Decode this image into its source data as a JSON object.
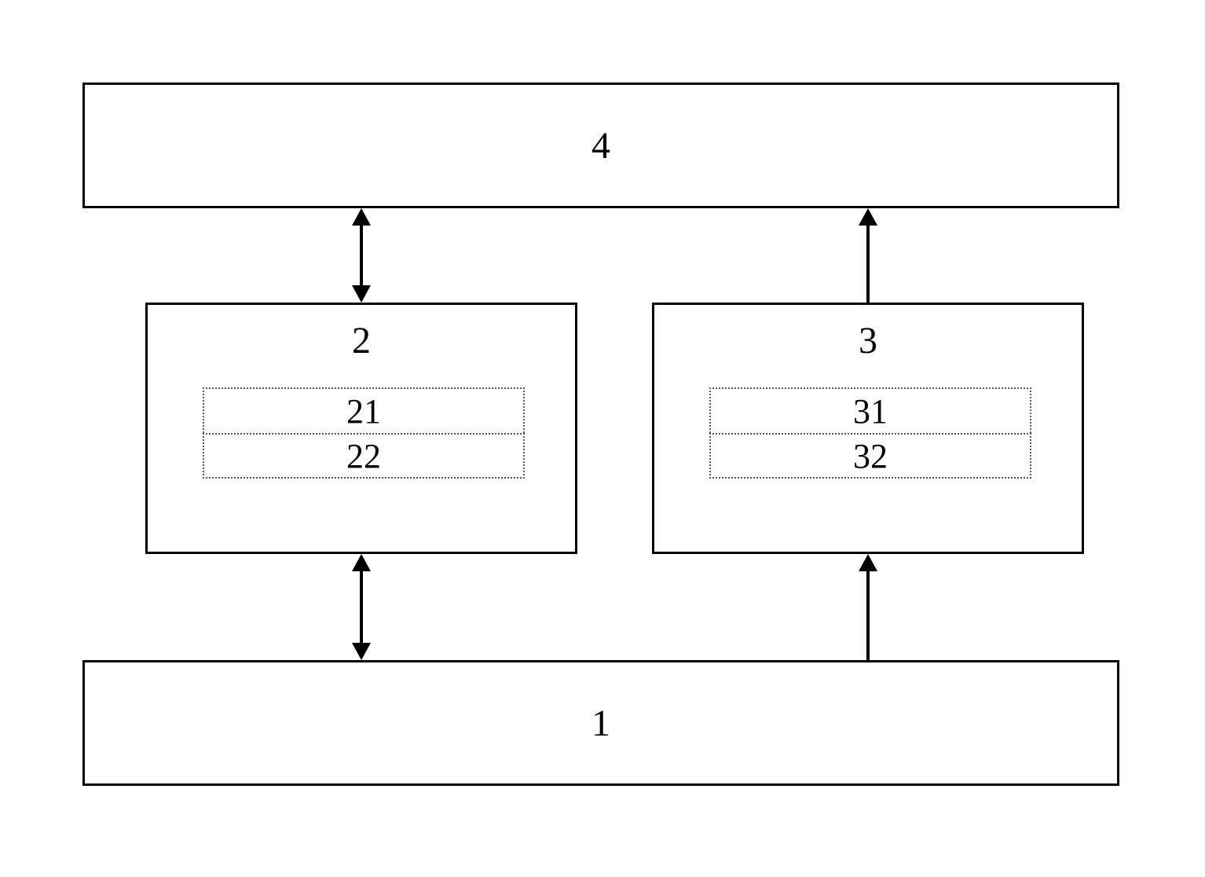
{
  "blocks": {
    "top": {
      "label": "4"
    },
    "left": {
      "label": "2",
      "inner": {
        "top": "21",
        "bottom": "22"
      }
    },
    "right": {
      "label": "3",
      "inner": {
        "top": "31",
        "bottom": "32"
      }
    },
    "bottom": {
      "label": "1"
    }
  }
}
